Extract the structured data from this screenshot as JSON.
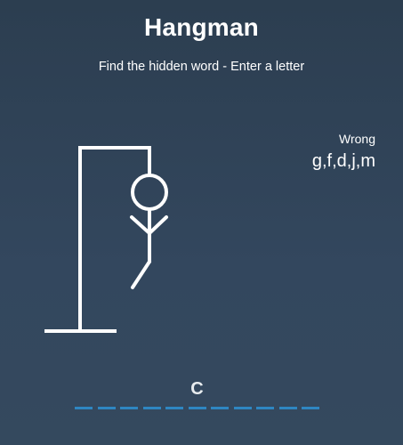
{
  "game": {
    "title": "Hangman",
    "subtitle": "Find the hidden word - Enter a letter"
  },
  "wrong": {
    "label": "Wrong",
    "letters": "g,f,d,j,m"
  },
  "word": {
    "letters": [
      "",
      "",
      "",
      "",
      "",
      "C",
      "",
      "",
      "",
      "",
      ""
    ],
    "dash_color": "#2e86c1"
  },
  "figure": {
    "parts_shown": [
      "head",
      "body",
      "left-arm",
      "right-arm",
      "left-leg"
    ]
  },
  "colors": {
    "background": "#2c3e50",
    "foreground": "#ffffff",
    "accent": "#2e86c1"
  }
}
